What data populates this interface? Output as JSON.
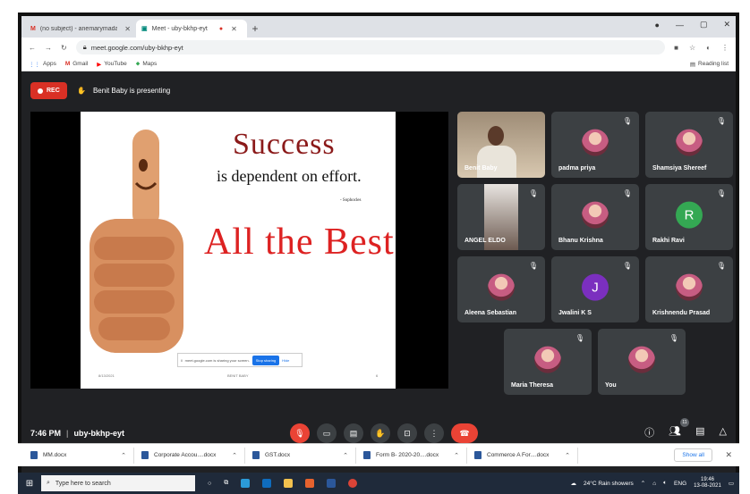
{
  "browser": {
    "tabs": [
      {
        "label": "(no subject) - anemarymadasser",
        "icon": "gmail-icon"
      },
      {
        "label": "Meet - uby-bkhp-eyt",
        "icon": "meet-icon",
        "active": true
      }
    ],
    "url": "meet.google.com/uby-bkhp-eyt",
    "bookmarks": [
      "Apps",
      "Gmail",
      "YouTube",
      "Maps"
    ],
    "reading_list": "Reading list"
  },
  "meet": {
    "rec_label": "REC",
    "presenting": "Benit Baby is presenting",
    "slide": {
      "line1": "Success",
      "line2": "is dependent on effort.",
      "attribution": "- Sophocles",
      "line3": "All the Best",
      "share_text": "meet.google.com is sharing your screen.",
      "stop_sharing": "Stop sharing",
      "hide": "Hide",
      "footer_name": "BENIT BABY",
      "footer_date": "8/13/2021",
      "footer_page": "6"
    },
    "participants": [
      {
        "name": "Benit Baby",
        "type": "camera"
      },
      {
        "name": "padma priya",
        "type": "photo"
      },
      {
        "name": "Shamsiya Shereef",
        "type": "photo"
      },
      {
        "name": "ANGEL ELDO",
        "type": "camera2"
      },
      {
        "name": "Bhanu Krishna",
        "type": "photo"
      },
      {
        "name": "Rakhi Ravi",
        "type": "letter",
        "letter": "R",
        "color": "#34a853"
      },
      {
        "name": "Aleena Sebastian",
        "type": "photo"
      },
      {
        "name": "Jwalini K S",
        "type": "letter",
        "letter": "J",
        "color": "#7b2fbf"
      },
      {
        "name": "Krishnendu Prasad",
        "type": "photo"
      },
      {
        "name": "Maria Theresa",
        "type": "photo"
      },
      {
        "name": "You",
        "type": "photo"
      }
    ],
    "time": "7:46 PM",
    "meeting_code": "uby-bkhp-eyt",
    "people_count": "11"
  },
  "downloads": {
    "items": [
      "MM.docx",
      "Corporate Accou....docx",
      "GST.docx",
      "Form B- 2020-20....docx",
      "Commerce A For....docx"
    ],
    "show_all": "Show all"
  },
  "taskbar": {
    "search_placeholder": "Type here to search",
    "weather": "24°C Rain showers",
    "lang": "ENG",
    "time": "19:46",
    "date": "13-08-2021"
  }
}
